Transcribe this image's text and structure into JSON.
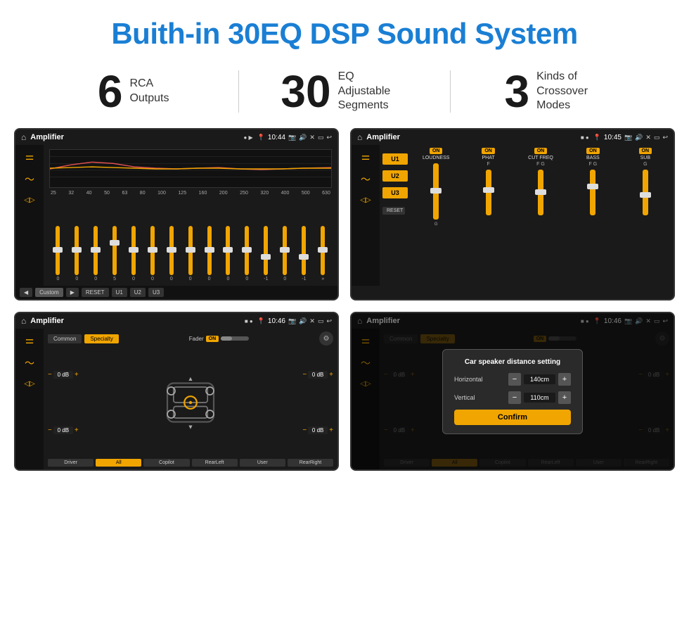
{
  "page": {
    "title": "Buith-in 30EQ DSP Sound System",
    "stats": [
      {
        "number": "6",
        "text_line1": "RCA",
        "text_line2": "Outputs"
      },
      {
        "number": "30",
        "text_line1": "EQ Adjustable",
        "text_line2": "Segments"
      },
      {
        "number": "3",
        "text_line1": "Kinds of",
        "text_line2": "Crossover Modes"
      }
    ]
  },
  "screen1": {
    "title": "Amplifier",
    "time": "10:44",
    "eq_labels": [
      "25",
      "32",
      "40",
      "50",
      "63",
      "80",
      "100",
      "125",
      "160",
      "200",
      "250",
      "320",
      "400",
      "500",
      "630"
    ],
    "eq_values": [
      "0",
      "0",
      "0",
      "5",
      "0",
      "0",
      "0",
      "0",
      "0",
      "0",
      "0",
      "-1",
      "0",
      "-1"
    ],
    "buttons": [
      "Custom",
      "RESET",
      "U1",
      "U2",
      "U3"
    ]
  },
  "screen2": {
    "title": "Amplifier",
    "time": "10:45",
    "presets": [
      "U1",
      "U2",
      "U3"
    ],
    "channels": [
      {
        "on": true,
        "label": "LOUDNESS"
      },
      {
        "on": true,
        "label": "PHAT"
      },
      {
        "on": true,
        "label": "CUT FREQ"
      },
      {
        "on": true,
        "label": "BASS"
      },
      {
        "on": true,
        "label": "SUB"
      }
    ],
    "reset_label": "RESET"
  },
  "screen3": {
    "title": "Amplifier",
    "time": "10:46",
    "tabs": [
      "Common",
      "Specialty"
    ],
    "fader_label": "Fader",
    "fader_on": "ON",
    "db_controls": [
      {
        "left": "0 dB",
        "right": "0 dB"
      },
      {
        "left": "0 dB",
        "right": "0 dB"
      }
    ],
    "bottom_buttons": [
      "Driver",
      "RearLeft",
      "All",
      "User",
      "Copilot",
      "RearRight"
    ]
  },
  "screen4": {
    "title": "Amplifier",
    "time": "10:46",
    "tabs": [
      "Common",
      "Specialty"
    ],
    "dialog": {
      "title": "Car speaker distance setting",
      "fields": [
        {
          "label": "Horizontal",
          "value": "140cm"
        },
        {
          "label": "Vertical",
          "value": "110cm"
        }
      ],
      "confirm_label": "Confirm"
    },
    "db_right": [
      "0 dB",
      "0 dB"
    ],
    "bottom_buttons": [
      "Driver",
      "RearLeft",
      "All",
      "User",
      "Copilot",
      "RearRight"
    ]
  }
}
